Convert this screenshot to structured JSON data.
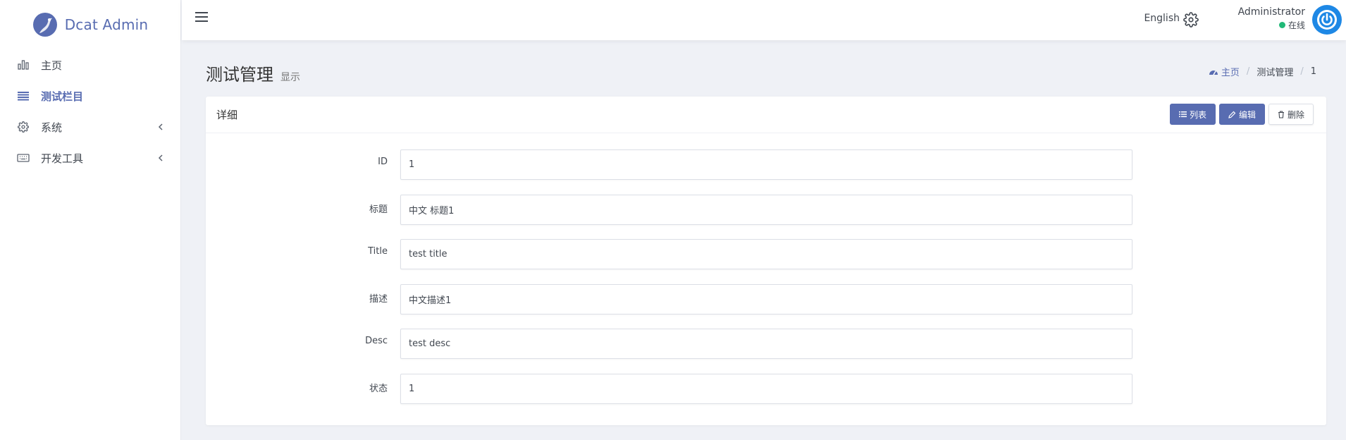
{
  "brand": {
    "name": "Dcat Admin",
    "accent": "#586cb1"
  },
  "sidebar": {
    "items": [
      {
        "label": "主页",
        "icon": "bar-chart-icon",
        "active": false,
        "has_children": false
      },
      {
        "label": "测试栏目",
        "icon": "list-icon",
        "active": true,
        "has_children": false
      },
      {
        "label": "系统",
        "icon": "gear-icon",
        "active": false,
        "has_children": true
      },
      {
        "label": "开发工具",
        "icon": "keyboard-icon",
        "active": false,
        "has_children": true
      }
    ]
  },
  "navbar": {
    "language": "English",
    "user_name": "Administrator",
    "user_status": "在线"
  },
  "page": {
    "title": "测试管理",
    "subtitle": "显示"
  },
  "breadcrumb": {
    "home": "主页",
    "section": "测试管理",
    "current": "1"
  },
  "card": {
    "title": "详细",
    "buttons": {
      "list": "列表",
      "edit": "编辑",
      "delete": "删除"
    }
  },
  "fields": [
    {
      "label": "ID",
      "value": "1"
    },
    {
      "label": "标题",
      "value": "中文 标题1"
    },
    {
      "label": "Title",
      "value": "test title"
    },
    {
      "label": "描述",
      "value": "中文描述1"
    },
    {
      "label": "Desc",
      "value": "test desc"
    },
    {
      "label": "状态",
      "value": "1"
    }
  ]
}
